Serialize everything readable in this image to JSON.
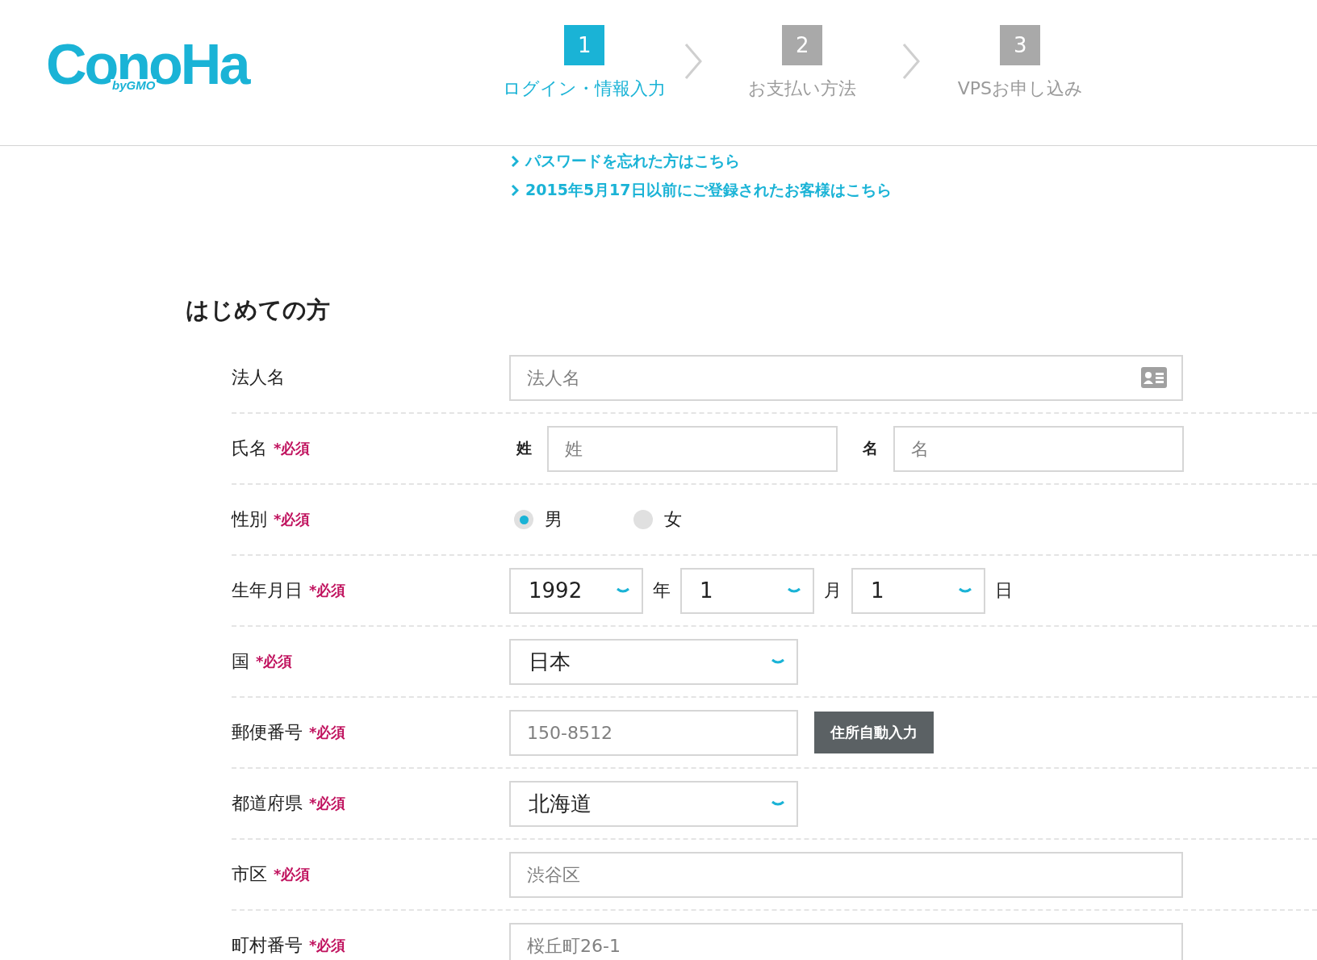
{
  "logo": {
    "wordmark": "ConoHa",
    "sub": "byGMO"
  },
  "steps": [
    {
      "number": "1",
      "label": "ログイン・情報入力",
      "selected": true
    },
    {
      "number": "2",
      "label": "お支払い方法",
      "selected": false
    },
    {
      "number": "3",
      "label": "VPSお申し込み",
      "selected": false
    }
  ],
  "links": [
    "パスワードを忘れた方はこちら",
    "2015年5月17日以前にご登録されたお客様はこちら"
  ],
  "section_title": "はじめての方",
  "rows": [
    {
      "kind": "text",
      "label": "法人名",
      "placeholder": "法人名",
      "card_icon": true
    },
    {
      "kind": "name",
      "label": "氏名",
      "required": "*必須",
      "parts": [
        {
          "label": "姓",
          "placeholder": "姓"
        },
        {
          "label": "名",
          "placeholder": "名"
        }
      ]
    },
    {
      "kind": "radio",
      "label": "性別",
      "required": "*必須",
      "options": [
        {
          "label": "男",
          "selected": true
        },
        {
          "label": "女",
          "selected": false
        }
      ]
    },
    {
      "kind": "date",
      "label": "生年月日",
      "required": "*必須",
      "parts": [
        {
          "value": "1992",
          "unit": "年"
        },
        {
          "value": "1",
          "unit": "月"
        },
        {
          "value": "1",
          "unit": "日"
        }
      ]
    },
    {
      "kind": "select",
      "label": "国",
      "required": "*必須",
      "value": "日本"
    },
    {
      "kind": "postal",
      "label": "郵便番号",
      "required": "*必須",
      "placeholder": "150-8512",
      "button": "住所自動入力"
    },
    {
      "kind": "select",
      "label": "都道府県",
      "required": "*必須",
      "value": "北海道"
    },
    {
      "kind": "text",
      "label": "市区",
      "required": "*必須",
      "placeholder": "渋谷区"
    },
    {
      "kind": "text",
      "label": "町村番号",
      "required": "*必須",
      "placeholder": "桜丘町26-1"
    }
  ]
}
